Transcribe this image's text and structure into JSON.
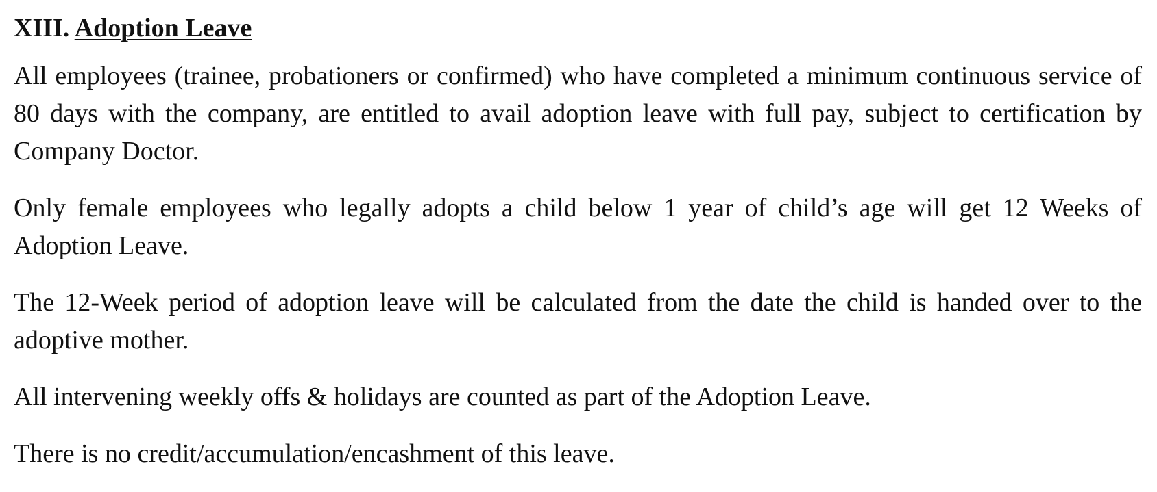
{
  "section": {
    "number": "XIII.",
    "title": "Adoption Leave"
  },
  "paragraphs": [
    "All employees (trainee, probationers or confirmed) who have completed a minimum continuous service of 80 days with the company, are entitled to avail adoption leave with full pay, subject to certification by Company Doctor.",
    "Only female employees who legally adopts a child below 1 year of child’s age will get 12 Weeks of Adoption Leave.",
    "The 12-Week period of adoption leave will be calculated from the date the child is handed over to the adoptive mother.",
    "All intervening weekly offs & holidays are counted as part of the Adoption Leave.",
    "There is no credit/accumulation/encashment of this leave."
  ]
}
